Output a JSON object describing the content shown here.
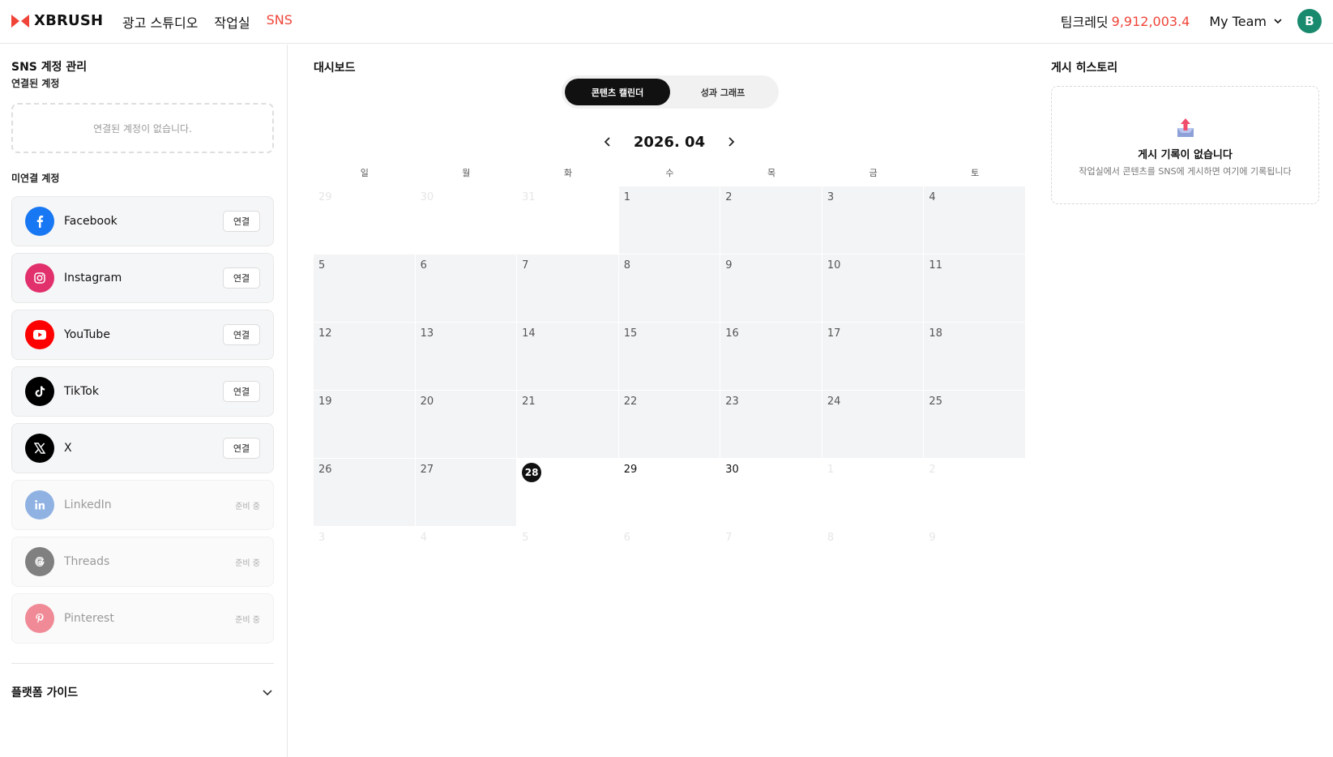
{
  "header": {
    "logo_text": "XBRUSH",
    "nav": [
      "광고 스튜디오",
      "작업실",
      "SNS"
    ],
    "credit_label": "팀크레딧",
    "credit_value": "9,912,003.4",
    "team_label": "My Team",
    "avatar_initial": "B"
  },
  "sidebar": {
    "title": "SNS 계정 관리",
    "connected_label": "연결된 계정",
    "connected_empty": "연결된 계정이 없습니다.",
    "unconnected_label": "미연결 계정",
    "accounts": [
      {
        "name": "Facebook",
        "action": "연결",
        "color": "#1877f2"
      },
      {
        "name": "Instagram",
        "action": "연결",
        "color": "#e1306c"
      },
      {
        "name": "YouTube",
        "action": "연결",
        "color": "#ff0000"
      },
      {
        "name": "TikTok",
        "action": "연결",
        "color": "#000000"
      },
      {
        "name": "X",
        "action": "연결",
        "color": "#000000"
      },
      {
        "name": "LinkedIn",
        "action": "준비 중",
        "color": "#0a66c2"
      },
      {
        "name": "Threads",
        "action": "준비 중",
        "color": "#000000"
      },
      {
        "name": "Pinterest",
        "action": "준비 중",
        "color": "#e60023"
      }
    ],
    "guide_label": "플랫폼 가이드"
  },
  "dashboard": {
    "title": "대시보드",
    "tabs": [
      "콘텐츠 캘린더",
      "성과 그래프"
    ],
    "active_tab": 0,
    "month_label": "2026. 04",
    "weekdays": [
      "일",
      "월",
      "화",
      "수",
      "목",
      "금",
      "토"
    ],
    "today": 28,
    "days": [
      "29",
      "30",
      "31",
      "1",
      "2",
      "3",
      "4",
      "5",
      "6",
      "7",
      "8",
      "9",
      "10",
      "11",
      "12",
      "13",
      "14",
      "15",
      "16",
      "17",
      "18",
      "19",
      "20",
      "21",
      "22",
      "23",
      "24",
      "25",
      "26",
      "27",
      "28",
      "29",
      "30",
      "1",
      "2",
      "3",
      "4",
      "5",
      "6",
      "7",
      "8",
      "9"
    ]
  },
  "history": {
    "title": "게시 히스토리",
    "empty_title": "게시 기록이 없습니다",
    "empty_sub": "작업실에서 콘텐츠를 SNS에 게시하면 여기에 기록됩니다"
  }
}
